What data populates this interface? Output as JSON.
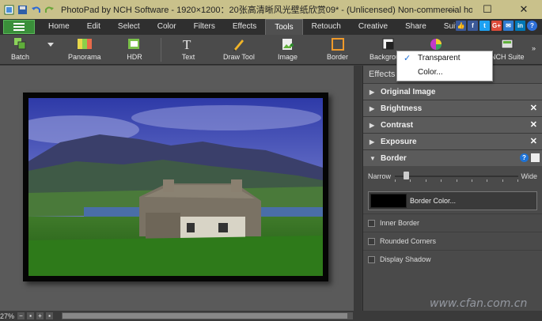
{
  "window": {
    "title": "PhotoPad by NCH Software - 1920×1200：20张高清晰风光壁纸欣赏09* - (Unlicensed) Non-commercial home use o...",
    "minimize": "─",
    "maximize": "☐",
    "close": "✕"
  },
  "menu": {
    "tabs": [
      {
        "label": "Home"
      },
      {
        "label": "Edit"
      },
      {
        "label": "Select"
      },
      {
        "label": "Color"
      },
      {
        "label": "Filters"
      },
      {
        "label": "Effects"
      },
      {
        "label": "Tools"
      },
      {
        "label": "Retouch"
      },
      {
        "label": "Creative"
      },
      {
        "label": "Share"
      },
      {
        "label": "Suite"
      }
    ],
    "active_tab": "Tools",
    "social": [
      "👍",
      "f",
      "t",
      "G+",
      "✉",
      "in"
    ]
  },
  "toolbar": {
    "batch": "Batch",
    "panorama": "Panorama",
    "hdr": "HDR",
    "text": "Text",
    "draw_tool": "Draw Tool",
    "image": "Image",
    "border": "Border",
    "background": "Background",
    "nch_suite": "NCH Suite",
    "more": "»"
  },
  "background_dropdown": {
    "items": [
      {
        "label": "Transparent",
        "checked": true
      },
      {
        "label": "Color...",
        "checked": false
      }
    ]
  },
  "panel": {
    "header": "Effects L",
    "sections": {
      "original": "Original Image",
      "brightness": "Brightness",
      "contrast": "Contrast",
      "exposure": "Exposure",
      "border": "Border"
    },
    "slider": {
      "left_label": "Narrow",
      "right_label": "Wide",
      "value": 0.09
    },
    "border_color_label": "Border Color...",
    "border_color": "#000000",
    "options": {
      "inner_border": "Inner Border",
      "rounded_corners": "Rounded Corners",
      "display_shadow": "Display Shadow"
    }
  },
  "status": {
    "zoom": "27%"
  },
  "watermark": "www.cfan.com.cn",
  "colors": {
    "accent_green": "#3a8f3a",
    "check_blue": "#1d6fd8"
  }
}
